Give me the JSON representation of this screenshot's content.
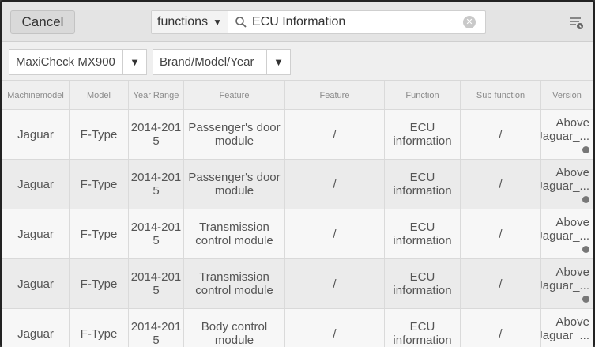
{
  "topbar": {
    "cancel_label": "Cancel",
    "search_type": "functions",
    "search_value": "ECU Information",
    "icons": [
      "search-icon",
      "clear-icon",
      "filter-icon"
    ]
  },
  "filters": {
    "device": "MaxiCheck MX900",
    "vehicle": "Brand/Model/Year"
  },
  "table": {
    "columns": [
      "Machinemodel",
      "Model",
      "Year Range",
      "Feature",
      "Feature",
      "Function",
      "Sub function",
      "Version"
    ],
    "rows": [
      {
        "machine": "Jaguar",
        "model": "F-Type",
        "year_a": "2014-201",
        "year_b": "5",
        "feature_a": "Passenger's door",
        "feature_b": "module",
        "feature2": "/",
        "function_a": "ECU",
        "function_b": "information",
        "sub": "/",
        "version_a": "Above",
        "version_b": "Jaguar_..."
      },
      {
        "machine": "Jaguar",
        "model": "F-Type",
        "year_a": "2014-201",
        "year_b": "5",
        "feature_a": "Passenger's door",
        "feature_b": "module",
        "feature2": "/",
        "function_a": "ECU",
        "function_b": "information",
        "sub": "/",
        "version_a": "Above",
        "version_b": "Jaguar_..."
      },
      {
        "machine": "Jaguar",
        "model": "F-Type",
        "year_a": "2014-201",
        "year_b": "5",
        "feature_a": "Transmission",
        "feature_b": "control module",
        "feature2": "/",
        "function_a": "ECU",
        "function_b": "information",
        "sub": "/",
        "version_a": "Above",
        "version_b": "Jaguar_..."
      },
      {
        "machine": "Jaguar",
        "model": "F-Type",
        "year_a": "2014-201",
        "year_b": "5",
        "feature_a": "Transmission",
        "feature_b": "control module",
        "feature2": "/",
        "function_a": "ECU",
        "function_b": "information",
        "sub": "/",
        "version_a": "Above",
        "version_b": "Jaguar_..."
      },
      {
        "machine": "Jaguar",
        "model": "F-Type",
        "year_a": "2014-201",
        "year_b": "5",
        "feature_a": "Body control",
        "feature_b": "module",
        "feature2": "/",
        "function_a": "ECU",
        "function_b": "information",
        "sub": "/",
        "version_a": "Above",
        "version_b": "Jaguar_..."
      }
    ]
  }
}
